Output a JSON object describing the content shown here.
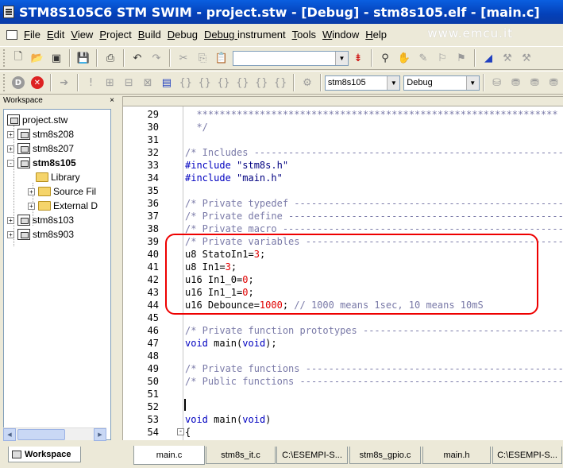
{
  "window": {
    "title": "STM8S105C6 STM SWIM - project.stw - [Debug] - stm8s105.elf - [main.c]"
  },
  "watermark": "www.emcu.it",
  "menu": [
    {
      "key": "F",
      "rest": "ile"
    },
    {
      "key": "E",
      "rest": "dit"
    },
    {
      "key": "V",
      "rest": "iew"
    },
    {
      "key": "P",
      "rest": "roject"
    },
    {
      "key": "B",
      "rest": "uild"
    },
    {
      "key": "D",
      "rest": "ebug"
    },
    {
      "key": "Debug ",
      "rest": "instrument"
    },
    {
      "key": "T",
      "rest": "ools"
    },
    {
      "key": "W",
      "rest": "indow"
    },
    {
      "key": "H",
      "rest": "elp"
    }
  ],
  "toolbar2": {
    "project_combo": "stm8s105",
    "config_combo": "Debug"
  },
  "workspace": {
    "panel_title": "Workspace",
    "tab_label": "Workspace",
    "tree": {
      "root": "project.stw",
      "items": [
        {
          "label": "stm8s208",
          "bold": false
        },
        {
          "label": "stm8s207",
          "bold": false
        },
        {
          "label": "stm8s105",
          "bold": true
        },
        {
          "label": "Library",
          "bold": false
        },
        {
          "label": "Source Fil",
          "bold": false
        },
        {
          "label": "External D",
          "bold": false
        },
        {
          "label": "stm8s103",
          "bold": false
        },
        {
          "label": "stm8s903",
          "bold": false
        }
      ]
    }
  },
  "editor": {
    "lines": [
      {
        "n": "29",
        "parts": [
          [
            "c",
            "  ***************************************************************"
          ]
        ]
      },
      {
        "n": "30",
        "parts": [
          [
            "c",
            "  */"
          ]
        ]
      },
      {
        "n": "31",
        "parts": []
      },
      {
        "n": "32",
        "parts": [
          [
            "c",
            "/* Includes ------------------------------------------------------"
          ]
        ]
      },
      {
        "n": "33",
        "parts": [
          [
            "k",
            "#include "
          ],
          [
            "s",
            "\"stm8s.h\""
          ]
        ]
      },
      {
        "n": "34",
        "parts": [
          [
            "k",
            "#include "
          ],
          [
            "s",
            "\"main.h\""
          ]
        ]
      },
      {
        "n": "35",
        "parts": []
      },
      {
        "n": "36",
        "parts": [
          [
            "c",
            "/* Private typedef -----------------------------------------------"
          ]
        ]
      },
      {
        "n": "37",
        "parts": [
          [
            "c",
            "/* Private define ------------------------------------------------"
          ]
        ]
      },
      {
        "n": "38",
        "parts": [
          [
            "c",
            "/* Private macro -------------------------------------------------"
          ]
        ]
      },
      {
        "n": "39",
        "parts": [
          [
            "c",
            "/* Private variables ---------------------------------------------"
          ]
        ]
      },
      {
        "n": "40",
        "parts": [
          [
            "p",
            "u8 StatoIn1="
          ],
          [
            "n",
            "3"
          ],
          [
            "p",
            ";"
          ]
        ]
      },
      {
        "n": "41",
        "parts": [
          [
            "p",
            "u8 In1="
          ],
          [
            "n",
            "3"
          ],
          [
            "p",
            ";"
          ]
        ]
      },
      {
        "n": "42",
        "parts": [
          [
            "p",
            "u16 In1_0="
          ],
          [
            "n",
            "0"
          ],
          [
            "p",
            ";"
          ]
        ]
      },
      {
        "n": "43",
        "parts": [
          [
            "p",
            "u16 In1_1="
          ],
          [
            "n",
            "0"
          ],
          [
            "p",
            ";"
          ]
        ]
      },
      {
        "n": "44",
        "parts": [
          [
            "p",
            "u16 Debounce="
          ],
          [
            "n",
            "1000"
          ],
          [
            "p",
            "; "
          ],
          [
            "c",
            "// 1000 means 1sec, 10 means 10mS"
          ]
        ]
      },
      {
        "n": "45",
        "parts": []
      },
      {
        "n": "46",
        "parts": [
          [
            "c",
            "/* Private function prototypes -----------------------------------"
          ]
        ]
      },
      {
        "n": "47",
        "parts": [
          [
            "k",
            "void"
          ],
          [
            "p",
            " main("
          ],
          [
            "k",
            "void"
          ],
          [
            "p",
            ");"
          ]
        ]
      },
      {
        "n": "48",
        "parts": []
      },
      {
        "n": "49",
        "parts": [
          [
            "c",
            "/* Private functions ---------------------------------------------"
          ]
        ]
      },
      {
        "n": "50",
        "parts": [
          [
            "c",
            "/* Public functions ----------------------------------------------"
          ]
        ]
      },
      {
        "n": "51",
        "parts": []
      },
      {
        "n": "52",
        "parts": []
      },
      {
        "n": "53",
        "parts": [
          [
            "k",
            "void"
          ],
          [
            "p",
            " main("
          ],
          [
            "k",
            "void"
          ],
          [
            "p",
            ")"
          ]
        ]
      },
      {
        "n": "54",
        "parts": [
          [
            "p",
            "{"
          ]
        ]
      }
    ]
  },
  "file_tabs": [
    "main.c",
    "stm8s_it.c",
    "C:\\ESEMPI-S...",
    "stm8s_gpio.c",
    "main.h",
    "C:\\ESEMPI-S..."
  ]
}
